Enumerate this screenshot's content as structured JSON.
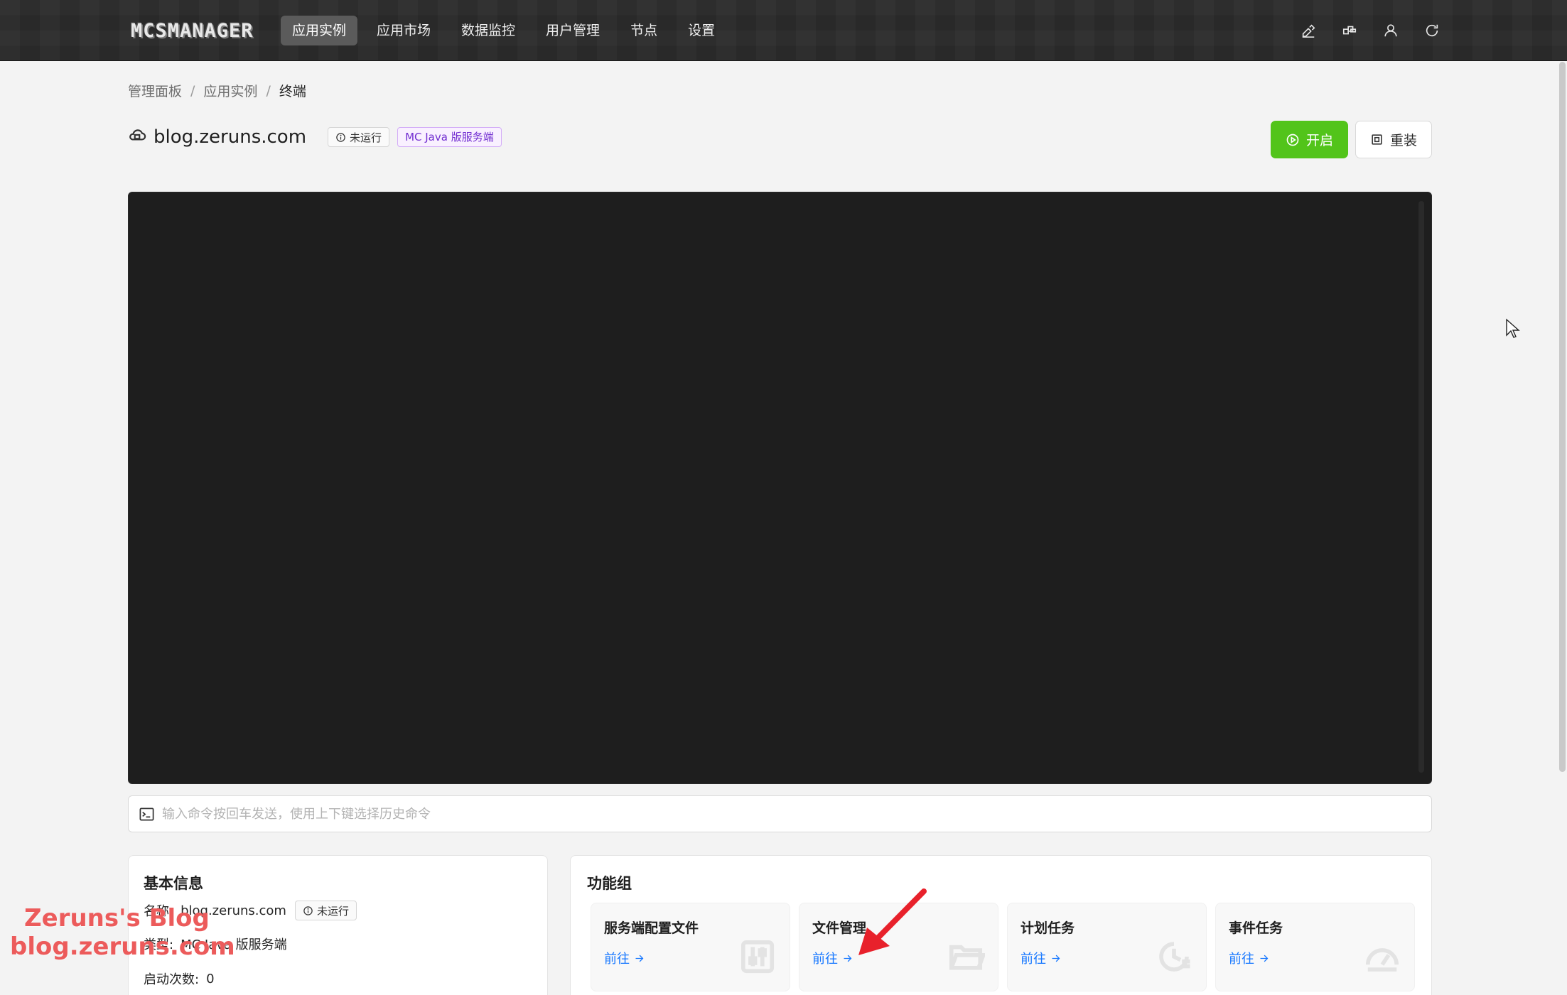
{
  "app": {
    "logo": "MCSMANAGER"
  },
  "nav": {
    "items": [
      {
        "label": "应用实例",
        "active": true
      },
      {
        "label": "应用市场",
        "active": false
      },
      {
        "label": "数据监控",
        "active": false
      },
      {
        "label": "用户管理",
        "active": false
      },
      {
        "label": "节点",
        "active": false
      },
      {
        "label": "设置",
        "active": false
      }
    ],
    "icons": [
      "theme-brush-icon",
      "layout-icon",
      "user-icon",
      "refresh-icon"
    ]
  },
  "breadcrumb": {
    "items": [
      "管理面板",
      "应用实例"
    ],
    "current": "终端",
    "separator": "/"
  },
  "instance": {
    "name": "blog.zeruns.com",
    "status": "未运行",
    "type": "MC Java 版服务端",
    "start_label": "开启",
    "reinstall_label": "重装",
    "start_color": "#52c41a"
  },
  "terminal": {
    "background": "#1e1e1e",
    "command_placeholder": "输入命令按回车发送，使用上下键选择历史命令"
  },
  "basic_info": {
    "title": "基本信息",
    "name_label": "名称:",
    "name_value": "blog.zeruns.com",
    "status": "未运行",
    "type_label": "类型:",
    "type_value": "MC Java 版服务端",
    "starts_label": "启动次数:",
    "starts_value": "0"
  },
  "features": {
    "title": "功能组",
    "items": [
      {
        "name": "服务端配置文件",
        "link": "前往",
        "icon": "sliders-icon"
      },
      {
        "name": "文件管理",
        "link": "前往",
        "icon": "folder-icon"
      },
      {
        "name": "计划任务",
        "link": "前往",
        "icon": "clock-icon"
      },
      {
        "name": "事件任务",
        "link": "前往",
        "icon": "gauge-icon"
      }
    ]
  },
  "watermark": {
    "line1": "Zeruns's Blog",
    "line2": "blog.zeruns.com"
  }
}
